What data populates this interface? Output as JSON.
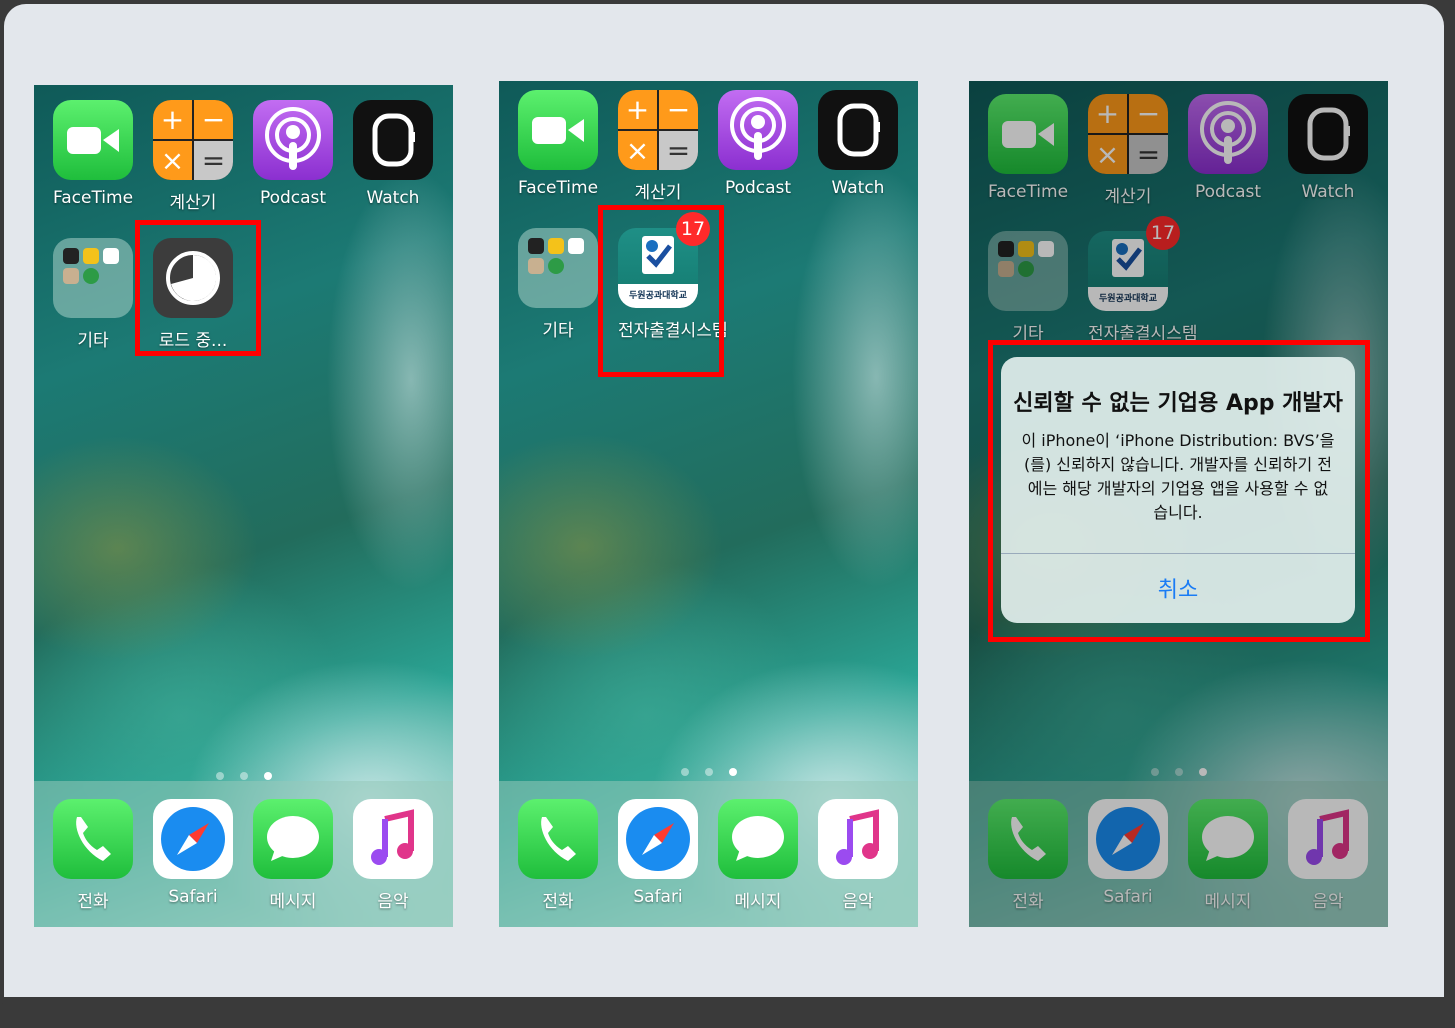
{
  "screens": [
    {
      "apps_row1": [
        "FaceTime",
        "계산기",
        "Podcast",
        "Watch"
      ],
      "apps_row2": [
        "기타",
        "로드 중..."
      ],
      "dock": [
        "전화",
        "Safari",
        "메시지",
        "음악"
      ]
    },
    {
      "apps_row1": [
        "FaceTime",
        "계산기",
        "Podcast",
        "Watch"
      ],
      "apps_row2": [
        "기타",
        "전자출결시스템"
      ],
      "badge": "17",
      "univ_logo_text": "두원공과대학교",
      "dock": [
        "전화",
        "Safari",
        "메시지",
        "음악"
      ]
    },
    {
      "apps_row1": [
        "FaceTime",
        "계산기",
        "Podcast",
        "Watch"
      ],
      "apps_row2": [
        "기타",
        "전자출결시스템"
      ],
      "badge": "17",
      "univ_logo_text": "두원공과대학교",
      "dock": [
        "전화",
        "Safari",
        "메시지",
        "음악"
      ],
      "alert": {
        "title": "신뢰할 수 없는 기업용 App 개발자",
        "message": "이 iPhone이 ‘iPhone Distribution: BVS’을(를) 신뢰하지 않습니다. 개발자를 신뢰하기 전에는 해당 개발자의 기업용 앱을 사용할 수 없습니다.",
        "cancel": "취소"
      }
    }
  ],
  "colors": {
    "highlight": "#ff0000",
    "badge": "#ff2a2a",
    "alert_button": "#1a7cf5"
  }
}
